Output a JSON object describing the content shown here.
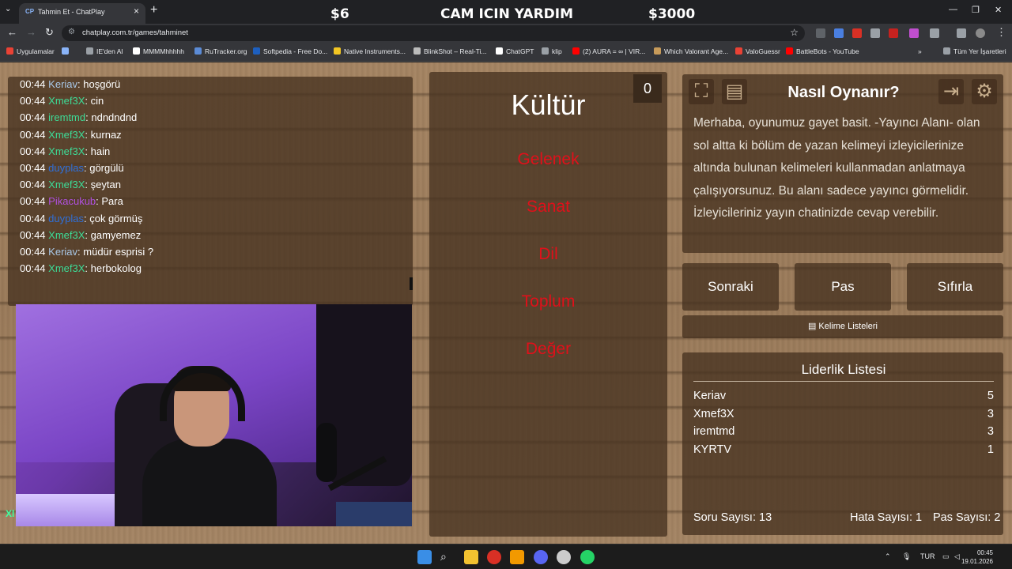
{
  "browser": {
    "tab_title": "Tahmin Et - ChatPlay",
    "tab_favicon": "CP",
    "url": "chatplay.com.tr/games/tahminet",
    "bookmarks": [
      {
        "label": "Uygulamalar",
        "color": "#e94235"
      },
      {
        "label": "",
        "color": "#8ab4f8"
      },
      {
        "label": "IE'den Al",
        "color": "#9aa0a6"
      },
      {
        "label": "MMMMhhhhh",
        "color": "#ffffff"
      },
      {
        "label": "RuTracker.org",
        "color": "#5b8bd6"
      },
      {
        "label": "Softpedia - Free Do...",
        "color": "#1d5fbf"
      },
      {
        "label": "Native Instruments...",
        "color": "#f3c623"
      },
      {
        "label": "BlinkShot – Real-Ti...",
        "color": "#bbbbbb"
      },
      {
        "label": "ChatGPT",
        "color": "#ffffff"
      },
      {
        "label": "klip",
        "color": "#9aa0a6"
      },
      {
        "label": "(2) AURA = ∞ | VIR...",
        "color": "#ff0000"
      },
      {
        "label": "Which Valorant Age...",
        "color": "#c79b5a"
      },
      {
        "label": "ValoGuessr",
        "color": "#e94235"
      },
      {
        "label": "BattleBots - YouTube",
        "color": "#ff0000"
      }
    ],
    "all_bookmarks": "Tüm Yer İşaretleri"
  },
  "stream_overlay": {
    "left": "$6",
    "center": "CAM ICIN YARDIM",
    "right": "$3000"
  },
  "chat": [
    {
      "time": "00:44",
      "user": "Keriav",
      "color": "#a8c8e8",
      "msg": "hoşgörü"
    },
    {
      "time": "00:44",
      "user": "Xmef3X",
      "color": "#3ddc97",
      "msg": "cin"
    },
    {
      "time": "00:44",
      "user": "iremtmd",
      "color": "#3ddc97",
      "msg": "ndndndnd"
    },
    {
      "time": "00:44",
      "user": "Xmef3X",
      "color": "#3ddc97",
      "msg": "kurnaz"
    },
    {
      "time": "00:44",
      "user": "Xmef3X",
      "color": "#3ddc97",
      "msg": "hain"
    },
    {
      "time": "00:44",
      "user": "duyplas",
      "color": "#2f6fd8",
      "msg": "görgülü"
    },
    {
      "time": "00:44",
      "user": "Xmef3X",
      "color": "#3ddc97",
      "msg": "şeytan"
    },
    {
      "time": "00:44",
      "user": "Pikacukub",
      "color": "#b050e0",
      "msg": "Para"
    },
    {
      "time": "00:44",
      "user": "duyplas",
      "color": "#2f6fd8",
      "msg": "çok görmüş"
    },
    {
      "time": "00:44",
      "user": "Xmef3X",
      "color": "#3ddc97",
      "msg": "gamyemez"
    },
    {
      "time": "00:44",
      "user": "Keriav",
      "color": "#a8c8e8",
      "msg": "müdür esprisi ?"
    },
    {
      "time": "00:44",
      "user": "Xmef3X",
      "color": "#3ddc97",
      "msg": "herbokolog"
    }
  ],
  "webcam": {
    "corner_label": "Xl"
  },
  "game": {
    "score": "0",
    "word": "Kültür",
    "taboo_words": [
      "Gelenek",
      "Sanat",
      "Dil",
      "Toplum",
      "Değer"
    ]
  },
  "howto": {
    "title": "Nasıl Oynanır?",
    "text": "Merhaba, oyunumuz gayet basit. -Yayıncı Alanı- olan sol altta ki bölüm de yazan kelimeyi izleyicilerinize altında bulunan kelimeleri kullanmadan anlatmaya çalışıyorsunuz. Bu alanı sadece yayıncı görmelidir. İzleyicileriniz yayın chatinizde cevap verebilir."
  },
  "actions": {
    "next": "Sonraki",
    "pass": "Pas",
    "reset": "Sıfırla",
    "word_lists": "Kelime Listeleri"
  },
  "leaderboard": {
    "title": "Liderlik Listesi",
    "rows": [
      {
        "name": "Keriav",
        "score": "5"
      },
      {
        "name": "Xmef3X",
        "score": "3"
      },
      {
        "name": "iremtmd",
        "score": "3"
      },
      {
        "name": "KYRTV",
        "score": "1"
      }
    ]
  },
  "stats": {
    "questions": "Soru Sayısı: 13",
    "errors": "Hata Sayısı: 1",
    "passes": "Pas Sayısı: 2"
  },
  "taskbar": {
    "lang": "TUR",
    "time": "00:45",
    "date": "19.01.2026"
  }
}
